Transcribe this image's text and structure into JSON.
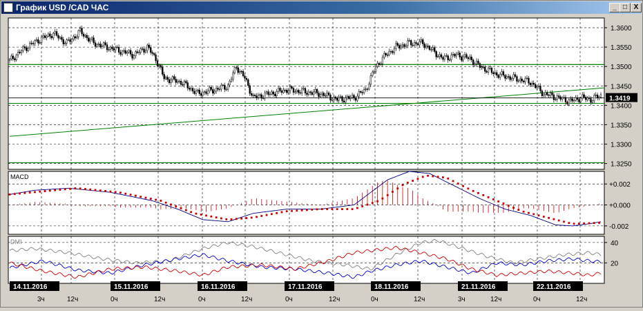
{
  "window": {
    "title": "График USD /CAD  ЧАС",
    "minimize": "_",
    "restore": "□",
    "close": "X"
  },
  "panels": {
    "price": {
      "ticks": [
        "1.3600",
        "1.3550",
        "1.3500",
        "1.3450",
        "1.3400",
        "1.3350",
        "1.3300",
        "1.3250"
      ],
      "tick_values": [
        1.36,
        1.355,
        1.35,
        1.345,
        1.34,
        1.335,
        1.33,
        1.325
      ],
      "current_price": "1.3419",
      "current_value": 1.3419,
      "ylim": [
        1.3235,
        1.3625
      ]
    },
    "macd": {
      "label": "MACD",
      "ticks": [
        "+0.002",
        "+0.000",
        "-0.002"
      ],
      "tick_values": [
        0.002,
        0,
        -0.002
      ],
      "ylim": [
        -0.0028,
        0.0032
      ]
    },
    "dmi": {
      "label": "DMI",
      "ticks": [
        "40",
        "20"
      ],
      "tick_values": [
        40,
        20
      ],
      "ylim": [
        0,
        46
      ]
    }
  },
  "date_labels": [
    "14.11.2016",
    "15.11.2016",
    "16.11.2016",
    "17.11.2016",
    "18.11.2016",
    "21.11.2016",
    "22.11.2016"
  ],
  "hour_labels": [
    {
      "t": "3ч",
      "x": 60
    },
    {
      "t": "12ч",
      "x": 103
    },
    {
      "t": "0ч",
      "x": 166
    },
    {
      "t": "12ч",
      "x": 229
    },
    {
      "t": "0ч",
      "x": 293
    },
    {
      "t": "12ч",
      "x": 355
    },
    {
      "t": "0ч",
      "x": 419
    },
    {
      "t": "12ч",
      "x": 482
    },
    {
      "t": "0ч",
      "x": 543
    },
    {
      "t": "12ч",
      "x": 605
    },
    {
      "t": "3ч",
      "x": 669
    },
    {
      "t": "12ч",
      "x": 716
    },
    {
      "t": "0ч",
      "x": 778
    },
    {
      "t": "12ч",
      "x": 840
    }
  ],
  "colors": {
    "grid": "#000000",
    "hline": "#008000",
    "candle": "#000000",
    "signal": "#cc0000",
    "macd": "#000080",
    "hist": "#cc0000",
    "dmi_plus": "#0000cc",
    "dmi_minus": "#cc0000",
    "adx": "#808080"
  },
  "chart_data": {
    "type": "candlestick",
    "title": "USD /CAD",
    "x_dates": [
      "14.11.2016",
      "15.11.2016",
      "16.11.2016",
      "17.11.2016",
      "18.11.2016",
      "21.11.2016",
      "22.11.2016"
    ],
    "close_keypoints": [
      [
        0,
        1.3515
      ],
      [
        4,
        1.353
      ],
      [
        10,
        1.355
      ],
      [
        18,
        1.357
      ],
      [
        26,
        1.3585
      ],
      [
        34,
        1.356
      ],
      [
        42,
        1.359
      ],
      [
        50,
        1.356
      ],
      [
        58,
        1.355
      ],
      [
        66,
        1.354
      ],
      [
        74,
        1.353
      ],
      [
        82,
        1.355
      ],
      [
        87,
        1.352
      ],
      [
        92,
        1.347
      ],
      [
        102,
        1.346
      ],
      [
        112,
        1.343
      ],
      [
        122,
        1.344
      ],
      [
        130,
        1.345
      ],
      [
        135,
        1.35
      ],
      [
        140,
        1.347
      ],
      [
        145,
        1.342
      ],
      [
        155,
        1.343
      ],
      [
        165,
        1.344
      ],
      [
        175,
        1.3435
      ],
      [
        185,
        1.343
      ],
      [
        195,
        1.3415
      ],
      [
        205,
        1.342
      ],
      [
        212,
        1.344
      ],
      [
        218,
        1.35
      ],
      [
        224,
        1.353
      ],
      [
        230,
        1.355
      ],
      [
        238,
        1.356
      ],
      [
        246,
        1.356
      ],
      [
        252,
        1.354
      ],
      [
        258,
        1.352
      ],
      [
        266,
        1.353
      ],
      [
        274,
        1.352
      ],
      [
        280,
        1.35
      ],
      [
        290,
        1.348
      ],
      [
        300,
        1.347
      ],
      [
        310,
        1.346
      ],
      [
        318,
        1.343
      ],
      [
        326,
        1.342
      ],
      [
        334,
        1.341
      ],
      [
        340,
        1.342
      ],
      [
        346,
        1.3415
      ],
      [
        352,
        1.3425
      ]
    ],
    "candle_count": 353,
    "hlines": [
      1.3505,
      1.3405,
      1.3252
    ],
    "trendline": {
      "from": [
        0,
        1.332
      ],
      "to": [
        352,
        1.3445
      ]
    },
    "macd_keypoints": [
      [
        0,
        0.001
      ],
      [
        15,
        0.0014
      ],
      [
        35,
        0.0016
      ],
      [
        60,
        0.0012
      ],
      [
        85,
        0.0004
      ],
      [
        100,
        -0.0004
      ],
      [
        115,
        -0.0014
      ],
      [
        130,
        -0.0016
      ],
      [
        145,
        -0.0008
      ],
      [
        165,
        -0.0004
      ],
      [
        185,
        -0.0004
      ],
      [
        205,
        0.0
      ],
      [
        215,
        0.0012
      ],
      [
        225,
        0.0024
      ],
      [
        238,
        0.0032
      ],
      [
        250,
        0.003
      ],
      [
        265,
        0.0018
      ],
      [
        280,
        0.0006
      ],
      [
        295,
        -0.0004
      ],
      [
        310,
        -0.001
      ],
      [
        325,
        -0.0019
      ],
      [
        335,
        -0.002
      ],
      [
        345,
        -0.0018
      ],
      [
        352,
        -0.0016
      ]
    ],
    "signal_keypoints": [
      [
        0,
        0.001
      ],
      [
        20,
        0.0013
      ],
      [
        40,
        0.0016
      ],
      [
        65,
        0.0012
      ],
      [
        90,
        0.0004
      ],
      [
        110,
        -0.0008
      ],
      [
        130,
        -0.0014
      ],
      [
        145,
        -0.0012
      ],
      [
        165,
        -0.0006
      ],
      [
        185,
        -0.0004
      ],
      [
        205,
        -0.0004
      ],
      [
        220,
        0.0004
      ],
      [
        235,
        0.002
      ],
      [
        248,
        0.0028
      ],
      [
        260,
        0.0026
      ],
      [
        275,
        0.0014
      ],
      [
        290,
        0.0004
      ],
      [
        305,
        -0.0006
      ],
      [
        320,
        -0.0012
      ],
      [
        335,
        -0.0018
      ],
      [
        352,
        -0.0017
      ]
    ],
    "dmi_plus_keypoints": [
      [
        0,
        15
      ],
      [
        20,
        22
      ],
      [
        40,
        13
      ],
      [
        60,
        10
      ],
      [
        80,
        18
      ],
      [
        100,
        24
      ],
      [
        115,
        28
      ],
      [
        130,
        22
      ],
      [
        150,
        16
      ],
      [
        170,
        14
      ],
      [
        190,
        10
      ],
      [
        205,
        6
      ],
      [
        215,
        12
      ],
      [
        230,
        18
      ],
      [
        245,
        22
      ],
      [
        260,
        16
      ],
      [
        275,
        10
      ],
      [
        290,
        20
      ],
      [
        305,
        18
      ],
      [
        320,
        22
      ],
      [
        335,
        24
      ],
      [
        345,
        22
      ],
      [
        352,
        21
      ]
    ],
    "dmi_minus_keypoints": [
      [
        0,
        20
      ],
      [
        20,
        12
      ],
      [
        40,
        6
      ],
      [
        60,
        14
      ],
      [
        80,
        16
      ],
      [
        100,
        12
      ],
      [
        115,
        8
      ],
      [
        130,
        16
      ],
      [
        150,
        18
      ],
      [
        170,
        14
      ],
      [
        190,
        22
      ],
      [
        205,
        30
      ],
      [
        215,
        32
      ],
      [
        230,
        35
      ],
      [
        245,
        30
      ],
      [
        260,
        24
      ],
      [
        275,
        14
      ],
      [
        290,
        8
      ],
      [
        305,
        10
      ],
      [
        320,
        12
      ],
      [
        335,
        10
      ],
      [
        345,
        8
      ],
      [
        352,
        10
      ]
    ],
    "adx_keypoints": [
      [
        0,
        32
      ],
      [
        15,
        34
      ],
      [
        35,
        30
      ],
      [
        55,
        24
      ],
      [
        75,
        20
      ],
      [
        95,
        22
      ],
      [
        115,
        34
      ],
      [
        130,
        40
      ],
      [
        145,
        36
      ],
      [
        160,
        30
      ],
      [
        180,
        22
      ],
      [
        200,
        18
      ],
      [
        215,
        14
      ],
      [
        230,
        28
      ],
      [
        245,
        40
      ],
      [
        255,
        42
      ],
      [
        270,
        34
      ],
      [
        285,
        26
      ],
      [
        300,
        20
      ],
      [
        315,
        24
      ],
      [
        330,
        28
      ],
      [
        345,
        30
      ],
      [
        352,
        28
      ]
    ]
  }
}
